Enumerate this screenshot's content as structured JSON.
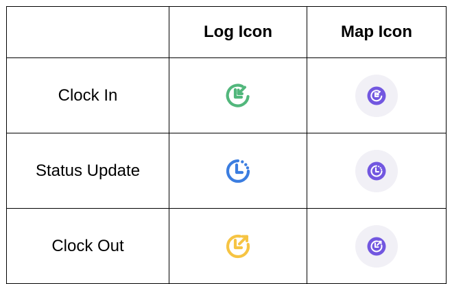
{
  "table": {
    "headers": [
      "",
      "Log Icon",
      "Map Icon"
    ],
    "rows": [
      {
        "event": "Clock In",
        "log_icon": "clock-in-icon",
        "map_icon": "clock-in-map-pin-icon",
        "color": "#52B77C"
      },
      {
        "event": "Status Update",
        "log_icon": "status-update-clock-icon",
        "map_icon": "status-update-map-pin-icon",
        "color": "#3B7DE0"
      },
      {
        "event": "Clock Out",
        "log_icon": "clock-out-icon",
        "map_icon": "clock-out-map-pin-icon",
        "color": "#F6C443"
      }
    ]
  },
  "colors": {
    "map_pin_fill": "#7257E0",
    "map_pin_halo": "#F1F0F6",
    "border": "#000000"
  }
}
